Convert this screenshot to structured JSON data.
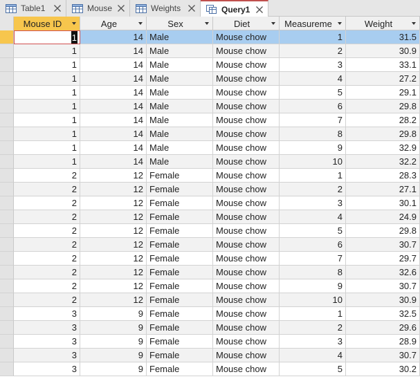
{
  "tabs": [
    {
      "label": "Table1",
      "icon": "table-icon",
      "active": false
    },
    {
      "label": "Mouse",
      "icon": "table-icon",
      "active": false
    },
    {
      "label": "Weights",
      "icon": "table-icon",
      "active": false
    },
    {
      "label": "Query1",
      "icon": "query-icon",
      "active": true
    }
  ],
  "columns": [
    "Mouse ID",
    "Age",
    "Sex",
    "Diet",
    "Measureme",
    "Weight"
  ],
  "rows": [
    [
      "1",
      "14",
      "Male",
      "Mouse chow",
      "1",
      "31.5"
    ],
    [
      "1",
      "14",
      "Male",
      "Mouse chow",
      "2",
      "30.9"
    ],
    [
      "1",
      "14",
      "Male",
      "Mouse chow",
      "3",
      "33.1"
    ],
    [
      "1",
      "14",
      "Male",
      "Mouse chow",
      "4",
      "27.2"
    ],
    [
      "1",
      "14",
      "Male",
      "Mouse chow",
      "5",
      "29.1"
    ],
    [
      "1",
      "14",
      "Male",
      "Mouse chow",
      "6",
      "29.8"
    ],
    [
      "1",
      "14",
      "Male",
      "Mouse chow",
      "7",
      "28.2"
    ],
    [
      "1",
      "14",
      "Male",
      "Mouse chow",
      "8",
      "29.8"
    ],
    [
      "1",
      "14",
      "Male",
      "Mouse chow",
      "9",
      "32.9"
    ],
    [
      "1",
      "14",
      "Male",
      "Mouse chow",
      "10",
      "32.2"
    ],
    [
      "2",
      "12",
      "Female",
      "Mouse chow",
      "1",
      "28.3"
    ],
    [
      "2",
      "12",
      "Female",
      "Mouse chow",
      "2",
      "27.1"
    ],
    [
      "2",
      "12",
      "Female",
      "Mouse chow",
      "3",
      "30.1"
    ],
    [
      "2",
      "12",
      "Female",
      "Mouse chow",
      "4",
      "24.9"
    ],
    [
      "2",
      "12",
      "Female",
      "Mouse chow",
      "5",
      "29.8"
    ],
    [
      "2",
      "12",
      "Female",
      "Mouse chow",
      "6",
      "30.7"
    ],
    [
      "2",
      "12",
      "Female",
      "Mouse chow",
      "7",
      "29.7"
    ],
    [
      "2",
      "12",
      "Female",
      "Mouse chow",
      "8",
      "32.6"
    ],
    [
      "2",
      "12",
      "Female",
      "Mouse chow",
      "9",
      "30.7"
    ],
    [
      "2",
      "12",
      "Female",
      "Mouse chow",
      "10",
      "30.9"
    ],
    [
      "3",
      "9",
      "Female",
      "Mouse chow",
      "1",
      "32.5"
    ],
    [
      "3",
      "9",
      "Female",
      "Mouse chow",
      "2",
      "29.6"
    ],
    [
      "3",
      "9",
      "Female",
      "Mouse chow",
      "3",
      "28.9"
    ],
    [
      "3",
      "9",
      "Female",
      "Mouse chow",
      "4",
      "30.7"
    ],
    [
      "3",
      "9",
      "Female",
      "Mouse chow",
      "5",
      "30.2"
    ]
  ],
  "colors": {
    "selected_header": "#f7c64d",
    "row_highlight": "#a8cdf0",
    "active_tab_accent": "#c0504d"
  }
}
